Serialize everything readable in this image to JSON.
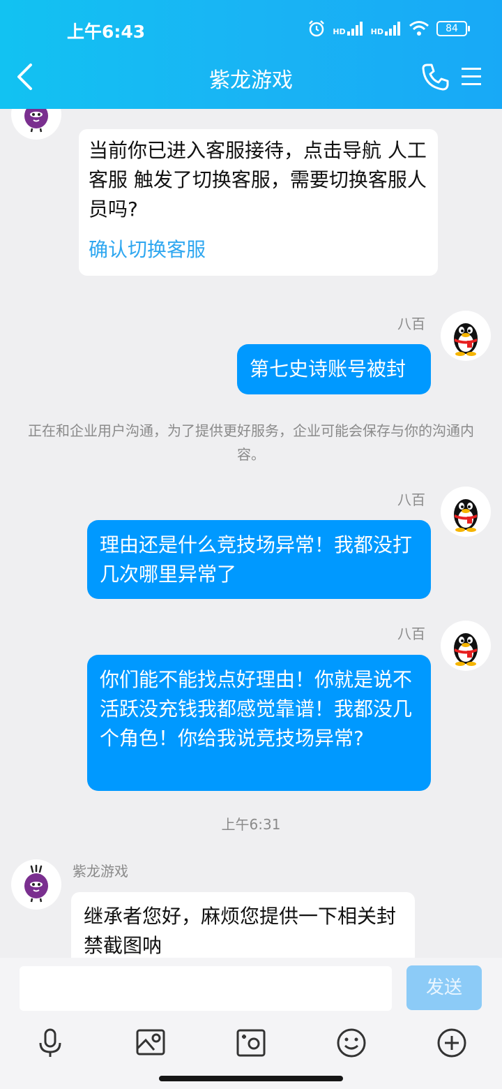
{
  "status_bar": {
    "time": "上午6:43",
    "hd1": "HD",
    "hd2": "HD",
    "battery": "84"
  },
  "header": {
    "title": "紫龙游戏"
  },
  "messages": {
    "m1": {
      "text": "当前你已进入客服接待，点击导航 人工客服 触发了切换客服，需要切换客服人员吗?",
      "link": "确认切换客服"
    },
    "m2": {
      "sender": "八百",
      "text": "第七史诗账号被封"
    },
    "system_notice": "正在和企业用户沟通，为了提供更好服务，企业可能会保存与你的沟通内容。",
    "m3": {
      "sender": "八百",
      "text": "理由还是什么竞技场异常！我都没打几次哪里异常了"
    },
    "m4": {
      "sender": "八百",
      "text": "你们能不能找点好理由！你就是说不活跃没充钱我都感觉靠谱！我都没几个角色！你给我说竞技场异常?"
    },
    "timestamp": "上午6:31",
    "m5": {
      "sender": "紫龙游戏",
      "text": "继承者您好，麻烦您提供一下相关封禁截图呐"
    }
  },
  "input": {
    "value": "",
    "send_label": "发送"
  },
  "toolbar": {
    "icons": [
      "microphone-icon",
      "image-icon",
      "camera-icon",
      "emoji-icon",
      "plus-icon"
    ]
  },
  "colors": {
    "header": "#19b4f4",
    "outgoing_bubble": "#0099ff",
    "link": "#2fa7f0",
    "send_disabled": "#8ccbf7"
  }
}
